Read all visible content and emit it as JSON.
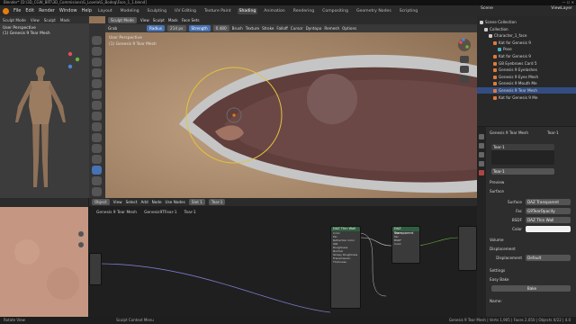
{
  "window": {
    "title": "Blender* [D:\\3D_CGW_BRT\\3D_Commisions\\G_Lovela\\G_Bodeg\\Face_1_1.blend]",
    "controls": "— ☐ ✕"
  },
  "menubar": {
    "items": [
      "File",
      "Edit",
      "Render",
      "Window",
      "Help"
    ],
    "workspaces": [
      "Layout",
      "Modeling",
      "Sculpting",
      "UV Editing",
      "Texture Paint",
      "Shading",
      "Animation",
      "Rendering",
      "Compositing",
      "Geometry Nodes",
      "Scripting"
    ],
    "active_workspace": "Shading",
    "scene": "Scene",
    "view_layer": "ViewLayer"
  },
  "left_viewport": {
    "mode": "Sculpt Mode",
    "menus": [
      "View",
      "Sculpt",
      "Mask"
    ],
    "label1": "User Perspective",
    "label2": "(1) Genesis 9 Tear Mesh"
  },
  "main_viewport": {
    "mode": "Sculpt Mode",
    "menus": [
      "View",
      "Sculpt",
      "Mask",
      "Face Sets"
    ],
    "label1": "User Perspective",
    "label2": "(1) Genesis 9 Tear Mesh",
    "tool_header": {
      "tool": "Grab",
      "radius_label": "Radius",
      "radius_value": "214 px",
      "strength_label": "Strength",
      "strength_value": "0.480",
      "menus": [
        "Brush",
        "Texture",
        "Stroke",
        "Falloff",
        "Cursor"
      ],
      "dyntopo": "Dyntopo",
      "remesh": "Remesh",
      "options": "Options"
    }
  },
  "outliner": {
    "rows": [
      {
        "label": "Scene Collection",
        "indent": 0,
        "color": "#cccccc",
        "sel": false
      },
      {
        "label": "Collection",
        "indent": 1,
        "color": "#cccccc",
        "sel": false
      },
      {
        "label": "Character_1_face",
        "indent": 2,
        "color": "#cccccc",
        "sel": false
      },
      {
        "label": "Kat for Genesis 9",
        "indent": 3,
        "color": "#e07b39",
        "sel": false
      },
      {
        "label": "Pose",
        "indent": 4,
        "color": "#4ab0c8",
        "sel": false
      },
      {
        "label": "Kat for Genesis 9",
        "indent": 3,
        "color": "#e07b39",
        "sel": false
      },
      {
        "label": "G8 Eyebrows Card 5",
        "indent": 3,
        "color": "#e07b39",
        "sel": false
      },
      {
        "label": "Genesis 9 Eyelashes",
        "indent": 3,
        "color": "#e07b39",
        "sel": false
      },
      {
        "label": "Genesis 9 Eyes Mesh",
        "indent": 3,
        "color": "#e07b39",
        "sel": false
      },
      {
        "label": "Genesis 9 Mouth Me",
        "indent": 3,
        "color": "#e07b39",
        "sel": false
      },
      {
        "label": "Genesis 9 Tear Mesh",
        "indent": 3,
        "color": "#e07b39",
        "sel": true
      },
      {
        "label": "Kat for Genesis 9 Me",
        "indent": 3,
        "color": "#e07b39",
        "sel": false
      }
    ]
  },
  "properties": {
    "object_name": "Genesis 9 Tear Mesh",
    "material_slot": "Tear-1",
    "slot_list": [
      "Tear-1"
    ],
    "material_name": "Tear-1",
    "sections": {
      "preview": "Preview",
      "surface": "Surface",
      "volume": "Volume",
      "displacement_section": "Displacement",
      "settings": "Settings",
      "easy_bake": "Easy Bake"
    },
    "surface_label": "Surface",
    "surface_value": "DAZ Transparent",
    "fac_label": "Fac",
    "fac_value": "G9TearOpacity",
    "bsdf_label": "BSDF",
    "bsdf_value": "DAZ Thin Wall",
    "color_label": "Color",
    "displacement_label": "Displacement",
    "displacement_value": "Default",
    "bake_button": "Bake",
    "name_label": "Name:"
  },
  "node_editor": {
    "header": {
      "editor": "Object",
      "menus": [
        "View",
        "Select",
        "Add",
        "Node"
      ],
      "use_nodes": "Use Nodes",
      "slot": "Slot 1",
      "material": "Tear-1"
    },
    "breadcrumb": [
      "Genesis 9 Tear Mesh",
      "Genesis9TFear-1",
      "Tear-1"
    ],
    "nodes": [
      {
        "title": "DAZ Thin Wall",
        "rows": [
          "Color",
          "Fac",
          "Refraction Color",
          "IOR",
          "Roughness",
          "Normal",
          "Glossy Roughness",
          "Transmission",
          "Thickness"
        ]
      },
      {
        "title": "DAZ Transparent",
        "rows": [
          "BSDF",
          "Fac",
          "BSDF",
          "Color"
        ]
      }
    ]
  },
  "status_bar": {
    "left": "Rotate View",
    "middle": "Sculpt Context Menu",
    "right": "Genesis 9 Tear Mesh | Verts 1,905 | Faces 2,050 | Objects 0/22 | 4.0"
  }
}
